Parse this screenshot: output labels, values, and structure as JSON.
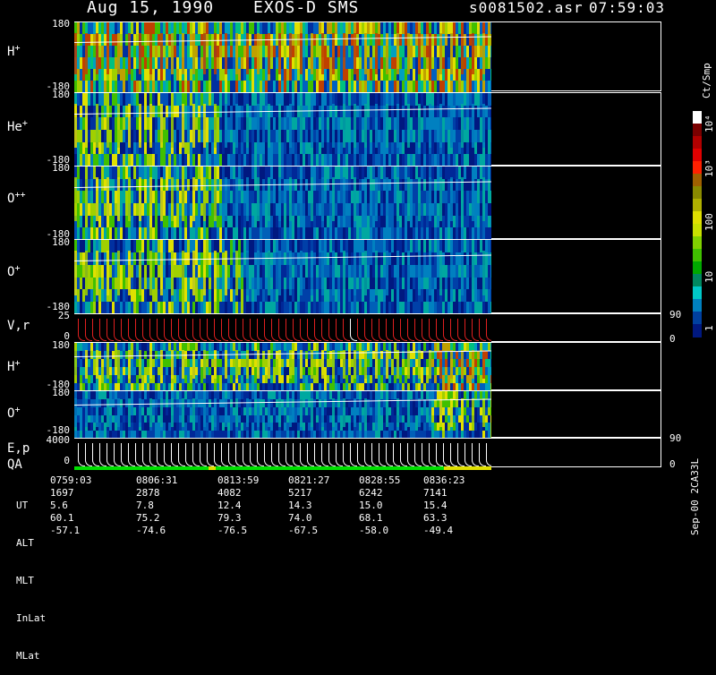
{
  "header": {
    "date": "Aug 15, 1990",
    "instrument": "EXOS-D SMS",
    "file": "s0081502.asr",
    "time": "07:59:03"
  },
  "panels": [
    {
      "label": "H+",
      "top_tick": "180",
      "bottom_tick": "-180"
    },
    {
      "label": "He+",
      "top_tick": "180",
      "bottom_tick": "-180"
    },
    {
      "label": "O++",
      "top_tick": "180",
      "bottom_tick": "-180"
    },
    {
      "label": "O+",
      "top_tick": "180",
      "bottom_tick": "-180"
    },
    {
      "label": "V,r",
      "top_tick": "25",
      "bottom_tick": "0",
      "right_top": "90",
      "right_bottom": "0"
    },
    {
      "label": "H+",
      "top_tick": "180",
      "bottom_tick": "-180"
    },
    {
      "label": "O+",
      "top_tick": "180",
      "bottom_tick": "-180"
    },
    {
      "label": "E,p",
      "top_tick": "4000",
      "bottom_tick": "0",
      "right_top": "90",
      "right_bottom": "0"
    }
  ],
  "qa_label": "QA",
  "colorbar": {
    "unit": "Ct/Smp",
    "ticks": [
      "10⁴",
      "10³",
      "100",
      "10",
      "1"
    ],
    "colors": [
      "#ffffff",
      "#7a0000",
      "#b00000",
      "#e00000",
      "#ff2000",
      "#a06000",
      "#8a8a00",
      "#b0b000",
      "#e0e000",
      "#c8e000",
      "#80d000",
      "#40c000",
      "#00a800",
      "#008860",
      "#00c8c8",
      "#0080c0",
      "#0040a0",
      "#001880"
    ]
  },
  "ephemeris": {
    "row_labels": [
      "UT",
      "ALT",
      "MLT",
      "InLat",
      "MLat"
    ],
    "columns": [
      [
        "0759:03",
        "1697",
        "5.6",
        "60.1",
        "-57.1"
      ],
      [
        "0806:31",
        "2878",
        "7.8",
        "75.2",
        "-74.6"
      ],
      [
        "0813:59",
        "4082",
        "12.4",
        "79.3",
        "-76.5"
      ],
      [
        "0821:27",
        "5217",
        "14.3",
        "74.0",
        "-67.5"
      ],
      [
        "0828:55",
        "6242",
        "15.0",
        "68.1",
        "-58.0"
      ],
      [
        "0836:23",
        "7141",
        "15.4",
        "63.3",
        "-49.4"
      ]
    ]
  },
  "side_id": "Sep-00 2CA33L"
}
